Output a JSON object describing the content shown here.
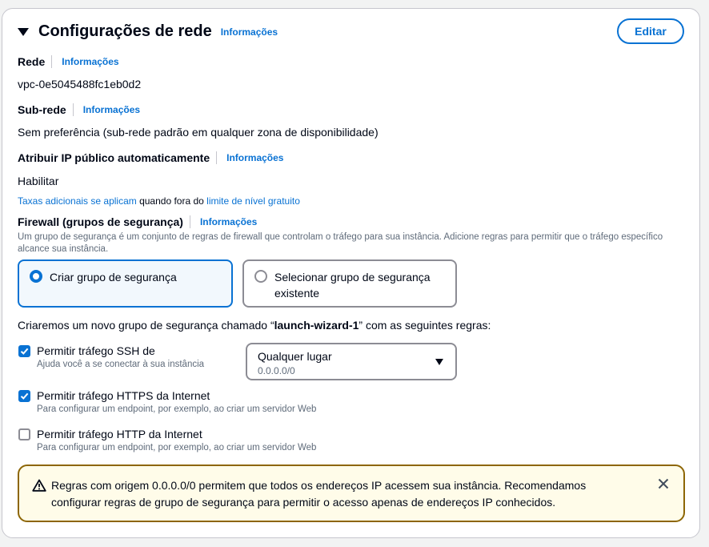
{
  "section": {
    "title": "Configurações de rede",
    "info_label": "Informações",
    "edit_label": "Editar"
  },
  "network": {
    "label": "Rede",
    "info": "Informações",
    "value": "vpc-0e5045488fc1eb0d2"
  },
  "subnet": {
    "label": "Sub-rede",
    "info": "Informações",
    "value": "Sem preferência (sub-rede padrão em qualquer zona de disponibilidade)"
  },
  "public_ip": {
    "label": "Atribuir IP público automaticamente",
    "info": "Informações",
    "value": "Habilitar",
    "note_link1": "Taxas adicionais se aplicam",
    "note_mid": " quando fora do ",
    "note_link2": "limite de nível gratuito"
  },
  "firewall": {
    "label": "Firewall (grupos de segurança)",
    "info": "Informações",
    "description": "Um grupo de segurança é um conjunto de regras de firewall que controlam o tráfego para sua instância. Adicione regras para permitir que o tráfego específico alcance sua instância.",
    "options": [
      {
        "label": "Criar grupo de segurança",
        "selected": true
      },
      {
        "label": "Selecionar grupo de segurança existente",
        "selected": false
      }
    ],
    "create_msg_prefix": "Criaremos um novo grupo de segurança chamado “",
    "create_msg_name": "launch-wizard-1",
    "create_msg_suffix": "” com as seguintes regras:"
  },
  "rules": [
    {
      "label": "Permitir tráfego SSH de",
      "description": "Ajuda você a se conectar à sua instância",
      "checked": true
    },
    {
      "label": "Permitir tráfego HTTPS da Internet",
      "description": "Para configurar um endpoint, por exemplo, ao criar um servidor Web",
      "checked": true
    },
    {
      "label": "Permitir tráfego HTTP da Internet",
      "description": "Para configurar um endpoint, por exemplo, ao criar um servidor Web",
      "checked": false
    }
  ],
  "ssh_source": {
    "selected": "Qualquer lugar",
    "sub": "0.0.0.0/0"
  },
  "warning": {
    "text": "Regras com origem 0.0.0.0/0 permitem que todos os endereços IP acessem sua instância. Recomendamos configurar regras de grupo de segurança para permitir o acesso apenas de endereços IP conhecidos.",
    "icon": "warning-triangle-icon"
  },
  "colors": {
    "accent": "#0972d3",
    "warning_border": "#8d6605",
    "warning_bg": "#fffce9"
  }
}
